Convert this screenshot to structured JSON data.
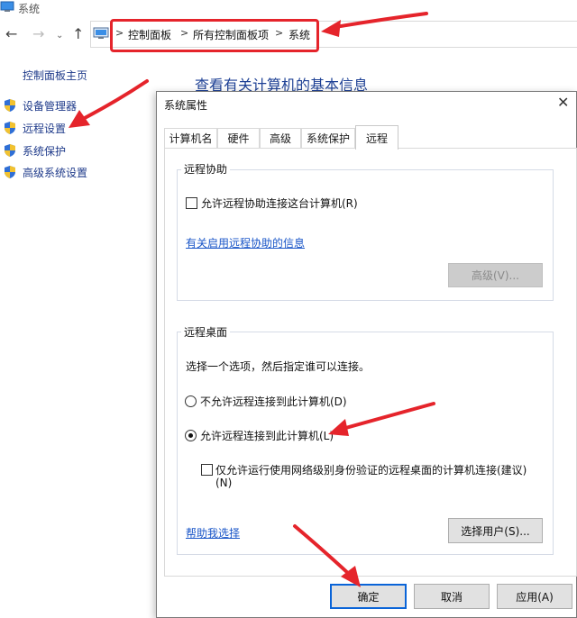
{
  "window": {
    "title": "系统"
  },
  "address": {
    "crumbs": [
      "控制面板",
      "所有控制面板项",
      "系统"
    ],
    "separator": ">"
  },
  "nav": {
    "back": "←",
    "forward": "→",
    "down": "⌄",
    "up": "↑"
  },
  "sidebar": {
    "home": "控制面板主页",
    "items": [
      {
        "label": "设备管理器"
      },
      {
        "label": "远程设置"
      },
      {
        "label": "系统保护"
      },
      {
        "label": "高级系统设置"
      }
    ]
  },
  "main": {
    "heading": "查看有关计算机的基本信息"
  },
  "dialog": {
    "title": "系统属性",
    "close": "✕",
    "tabs": [
      "计算机名",
      "硬件",
      "高级",
      "系统保护",
      "远程"
    ],
    "active_tab": 4,
    "remote_assistance": {
      "legend": "远程协助",
      "allow_checkbox": "允许远程协助连接这台计算机(R)",
      "allow_checked": false,
      "info_link": "有关启用远程协助的信息",
      "advanced_button": "高级(V)..."
    },
    "remote_desktop": {
      "legend": "远程桌面",
      "instruction": "选择一个选项，然后指定谁可以连接。",
      "option_deny": "不允许远程连接到此计算机(D)",
      "option_allow": "允许远程连接到此计算机(L)",
      "selected": "allow",
      "nla_line1": "仅允许运行使用网络级别身份验证的远程桌面的计算机连接(建议)",
      "nla_line2": "(N)",
      "nla_checked": false,
      "help_link": "帮助我选择",
      "select_users_button": "选择用户(S)..."
    },
    "buttons": {
      "ok": "确定",
      "cancel": "取消",
      "apply": "应用(A)"
    }
  },
  "colors": {
    "annotation": "#e5242b",
    "link": "#1a56c8",
    "default_button_border": "#0a64d8"
  }
}
